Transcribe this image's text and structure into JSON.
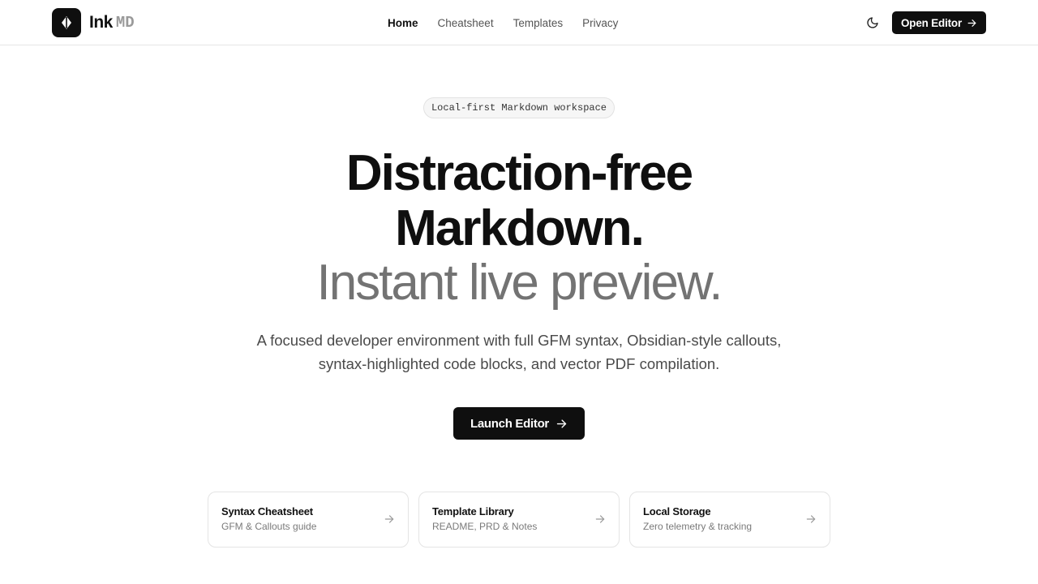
{
  "brand": {
    "name": "Ink",
    "suffix": "MD"
  },
  "nav": {
    "items": [
      {
        "label": "Home",
        "active": true
      },
      {
        "label": "Cheatsheet",
        "active": false
      },
      {
        "label": "Templates",
        "active": false
      },
      {
        "label": "Privacy",
        "active": false
      }
    ]
  },
  "header": {
    "theme_icon": "moon-icon",
    "open_editor_label": "Open Editor"
  },
  "hero": {
    "pill": "Local-first Markdown workspace",
    "headline_line1": "Distraction-free",
    "headline_line2": "Markdown.",
    "headline_line3": "Instant live preview.",
    "subtitle_line1": "A focused developer environment with full GFM syntax, Obsidian-style callouts,",
    "subtitle_line2": "syntax-highlighted code blocks, and vector PDF compilation.",
    "cta_label": "Launch Editor"
  },
  "cards": [
    {
      "title": "Syntax Cheatsheet",
      "desc": "GFM & Callouts guide"
    },
    {
      "title": "Template Library",
      "desc": "README, PRD & Notes"
    },
    {
      "title": "Local Storage",
      "desc": "Zero telemetry & tracking"
    }
  ],
  "colors": {
    "primary": "#0f0f0f",
    "muted_headline": "#737373",
    "border": "#e4e4e4"
  }
}
